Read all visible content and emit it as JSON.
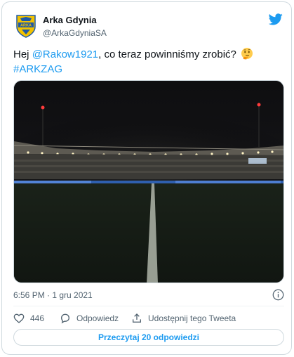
{
  "author": {
    "display_name": "Arka Gdynia",
    "handle": "@ArkaGdyniaSA",
    "avatar_text": "ARKA"
  },
  "tweet": {
    "text_prefix": "Hej ",
    "mention": "@Rakow1921",
    "text_suffix": ", co teraz powinniśmy zrobić?",
    "emoji": "thinking-face",
    "hashtag": "#ARKZAG"
  },
  "media": {
    "description": "dark-stadium-photo"
  },
  "meta": {
    "timestamp": "6:56 PM · 1 gru 2021"
  },
  "actions": {
    "like_count": "446",
    "reply_label": "Odpowiedz",
    "share_label": "Udostępnij tego Tweeta"
  },
  "read_replies_label": "Przeczytaj 20 odpowiedzi",
  "colors": {
    "accent": "#1d9bf0",
    "text": "#0f1419",
    "muted": "#536471",
    "border": "#cfd9de",
    "arka_yellow": "#f2c200",
    "arka_blue": "#1f5aa6"
  }
}
